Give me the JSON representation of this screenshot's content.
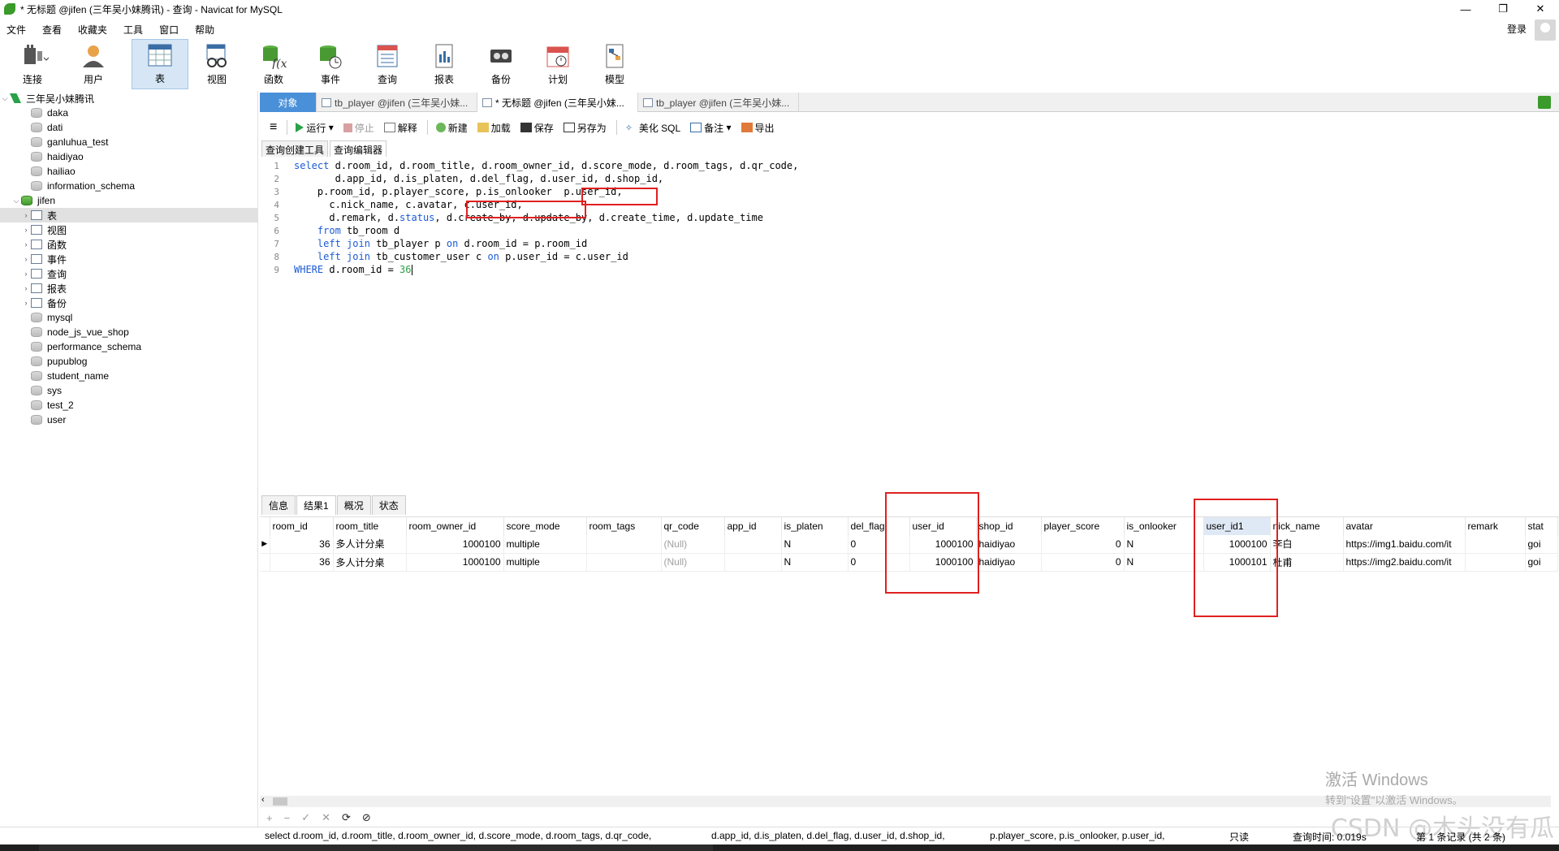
{
  "window": {
    "title": "* 无标题 @jifen (三年吴小妹腾讯) - 查询 - Navicat for MySQL",
    "controls": [
      "—",
      "❐",
      "✕"
    ]
  },
  "menu": [
    "文件",
    "查看",
    "收藏夹",
    "工具",
    "窗口",
    "帮助"
  ],
  "account": {
    "login_label": "登录"
  },
  "toolbar": {
    "connect": "连接",
    "user": "用户",
    "table": "表",
    "view": "视图",
    "function": "函数",
    "event": "事件",
    "query": "查询",
    "report": "报表",
    "backup": "备份",
    "schedule": "计划",
    "model": "模型"
  },
  "tree": {
    "connection": "三年吴小妹腾讯",
    "databases_before": [
      "daka",
      "dati",
      "ganluhua_test",
      "haidiyao",
      "hailiao",
      "information_schema"
    ],
    "open_db": "jifen",
    "open_children": [
      "表",
      "视图",
      "函数",
      "事件",
      "查询",
      "报表",
      "备份"
    ],
    "databases_after": [
      "mysql",
      "node_js_vue_shop",
      "performance_schema",
      "pupublog",
      "student_name",
      "sys",
      "test_2",
      "user"
    ]
  },
  "tabs": {
    "objects": "对象",
    "tab1": "tb_player @jifen (三年吴小妹...",
    "tab2": "* 无标题 @jifen (三年吴小妹...",
    "tab3": "tb_player @jifen (三年吴小妹..."
  },
  "query_toolbar": {
    "run": "运行",
    "stop": "停止",
    "explain": "解释",
    "new": "新建",
    "load": "加载",
    "save": "保存",
    "save_as": "另存为",
    "beautify": "美化 SQL",
    "comment": "备注",
    "export": "导出"
  },
  "editor_tabs": [
    "查询创建工具",
    "查询编辑器"
  ],
  "sql": {
    "l1": "d.room_id, d.room_title, d.room_owner_id, d.score_mode, d.room_tags, d.qr_code,",
    "l2": "       d.app_id, d.is_platen, d.del_flag, d.user_id, d.shop_id,",
    "l3": "    p.room_id, p.player_score, p.is_onlooker  p.user_id,",
    "l4": "      c.nick_name, c.avatar, c.user_id,",
    "l5a": "      d.remark, d.",
    "l5b": "status",
    "l5c": ", d.create_by, d.update_by, d.create_time, d.update_time",
    "l6": " tb_room d",
    "l7a": " tb_player p ",
    "l7b": " d.room_id = p.room_id",
    "l8a": " tb_customer_user c ",
    "l8b": " p.user_id = c.user_id",
    "l9a": " d.room_id = ",
    "l9b": "36",
    "kw_select": "select",
    "kw_from": "from",
    "kw_left_join": "left join",
    "kw_on": "on",
    "kw_where": "WHERE"
  },
  "result_tabs": [
    "信息",
    "结果1",
    "概况",
    "状态"
  ],
  "grid": {
    "columns": [
      "room_id",
      "room_title",
      "room_owner_id",
      "score_mode",
      "room_tags",
      "qr_code",
      "app_id",
      "is_platen",
      "del_flag",
      "user_id",
      "shop_id",
      "player_score",
      "is_onlooker",
      "user_id1",
      "nick_name",
      "avatar",
      "remark",
      "stat"
    ],
    "rows": [
      [
        "36",
        "多人计分桌",
        "1000100",
        "multiple",
        "",
        "(Null)",
        "",
        "N",
        "0",
        "1000100",
        "haidiyao",
        "0",
        "N",
        "1000100",
        "李白",
        "https://img1.baidu.com/it",
        "",
        "goi"
      ],
      [
        "36",
        "多人计分桌",
        "1000100",
        "multiple",
        "",
        "(Null)",
        "",
        "N",
        "0",
        "1000100",
        "haidiyao",
        "0",
        "N",
        "1000101",
        "杜甫",
        "https://img2.baidu.com/it",
        "",
        "goi"
      ]
    ]
  },
  "navbar": [
    "+",
    "−",
    "✓",
    "✕",
    "⟳",
    "⊘"
  ],
  "status": {
    "sql1": "select d.room_id, d.room_title, d.room_owner_id, d.score_mode, d.room_tags, d.qr_code,",
    "sql2": "d.app_id, d.is_platen, d.del_flag, d.user_id, d.shop_id,",
    "sql3": "p.player_score, p.is_onlooker, p.user_id,",
    "readonly": "只读",
    "query_time": "查询时间: 0.019s",
    "record": "第 1 条记录 (共 2 条)"
  },
  "watermark": {
    "line1": "激活 Windows",
    "line2": "转到\"设置\"以激活 Windows。",
    "csdn": "CSDN @木头没有瓜"
  },
  "colors": {
    "accent": "#4a90d9",
    "highlight_box": "#e02020",
    "keyword": "#1a5ad6",
    "number": "#2aa148"
  }
}
